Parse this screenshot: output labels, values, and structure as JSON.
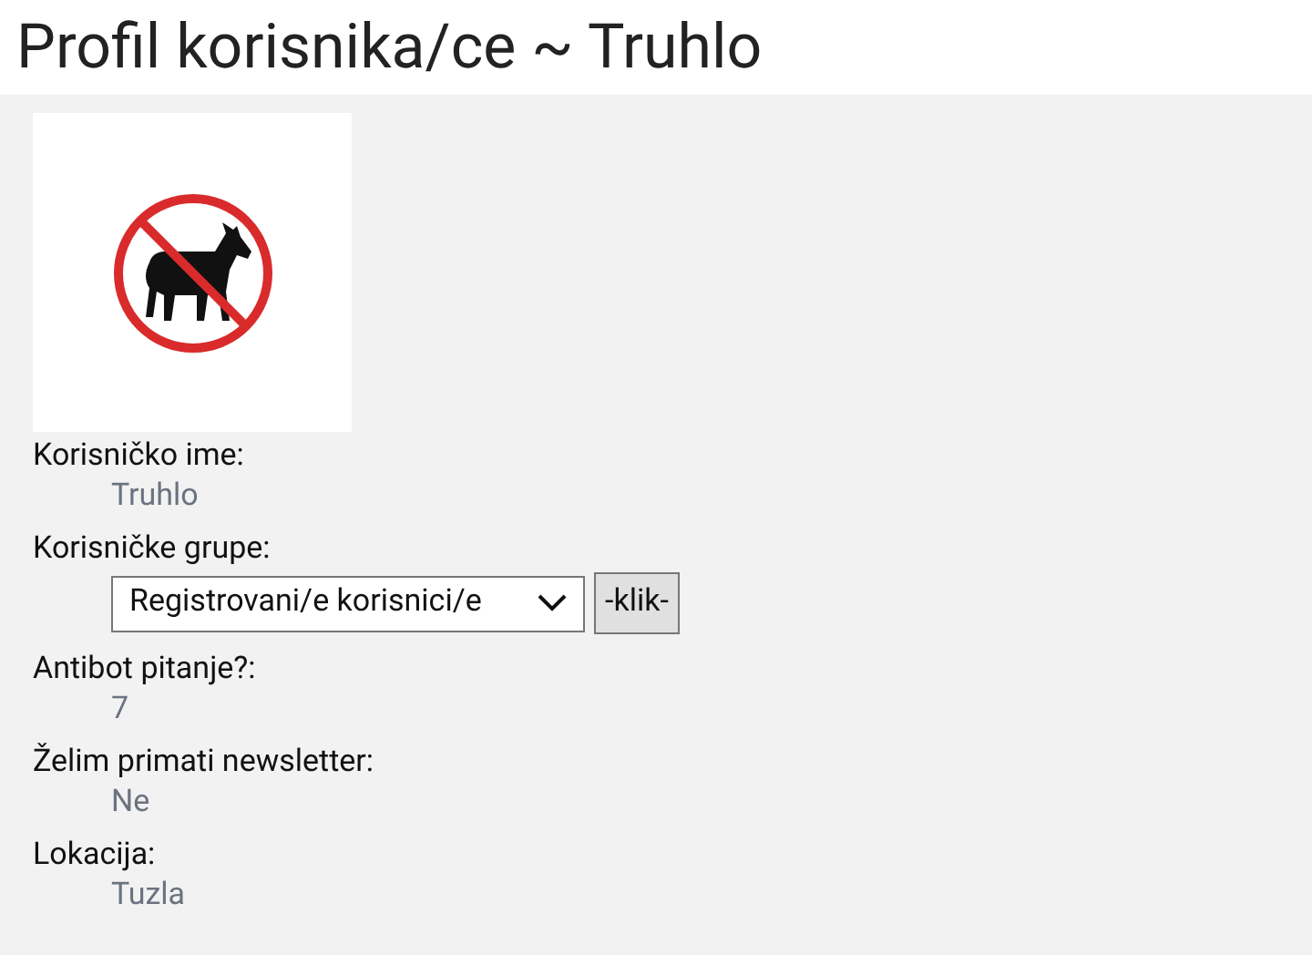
{
  "title": "Profil korisnika/ce ~ Truhlo",
  "fields": [
    {
      "kind": "text",
      "label": "Korisničko ime:",
      "value": "Truhlo"
    },
    {
      "kind": "select",
      "label": "Korisničke grupe:",
      "value": "Registrovani/e korisnici/e",
      "button": "-klik-"
    },
    {
      "kind": "text",
      "label": "Antibot pitanje?:",
      "value": "7"
    },
    {
      "kind": "text",
      "label": "Želim primati newsletter:",
      "value": "Ne"
    },
    {
      "kind": "text",
      "label": "Lokacija:",
      "value": "Tuzla"
    }
  ]
}
